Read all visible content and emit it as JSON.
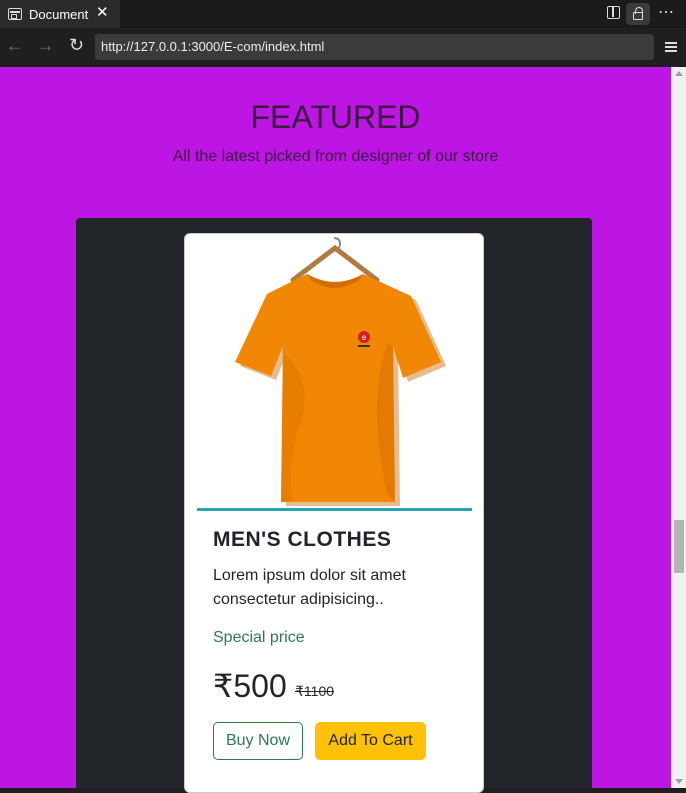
{
  "browser": {
    "tab_title": "Document",
    "close_glyph": "✕",
    "url": "http://127.0.0.1:3000/E-com/index.html",
    "icons": [
      "document-icon",
      "close-icon",
      "split-view-icon",
      "lock-icon",
      "more-icon",
      "back-icon",
      "forward-icon",
      "reload-icon",
      "menu-icon"
    ]
  },
  "page": {
    "heading": "FEATURED",
    "subheading": "All the latest picked from designer of our store",
    "background_color": "#bd15e3"
  },
  "product_card": {
    "image_alt": "orange t-shirt on hanger",
    "title": "MEN'S CLOTHES",
    "description": "Lorem ipsum dolor sit amet consectetur adipisicing..",
    "special_label": "Special price",
    "price": "₹500",
    "old_price": "₹1100",
    "buy_label": "Buy Now",
    "cart_label": "Add To Cart",
    "accent_color": "#ffc107",
    "special_color": "#2d7a4f"
  }
}
